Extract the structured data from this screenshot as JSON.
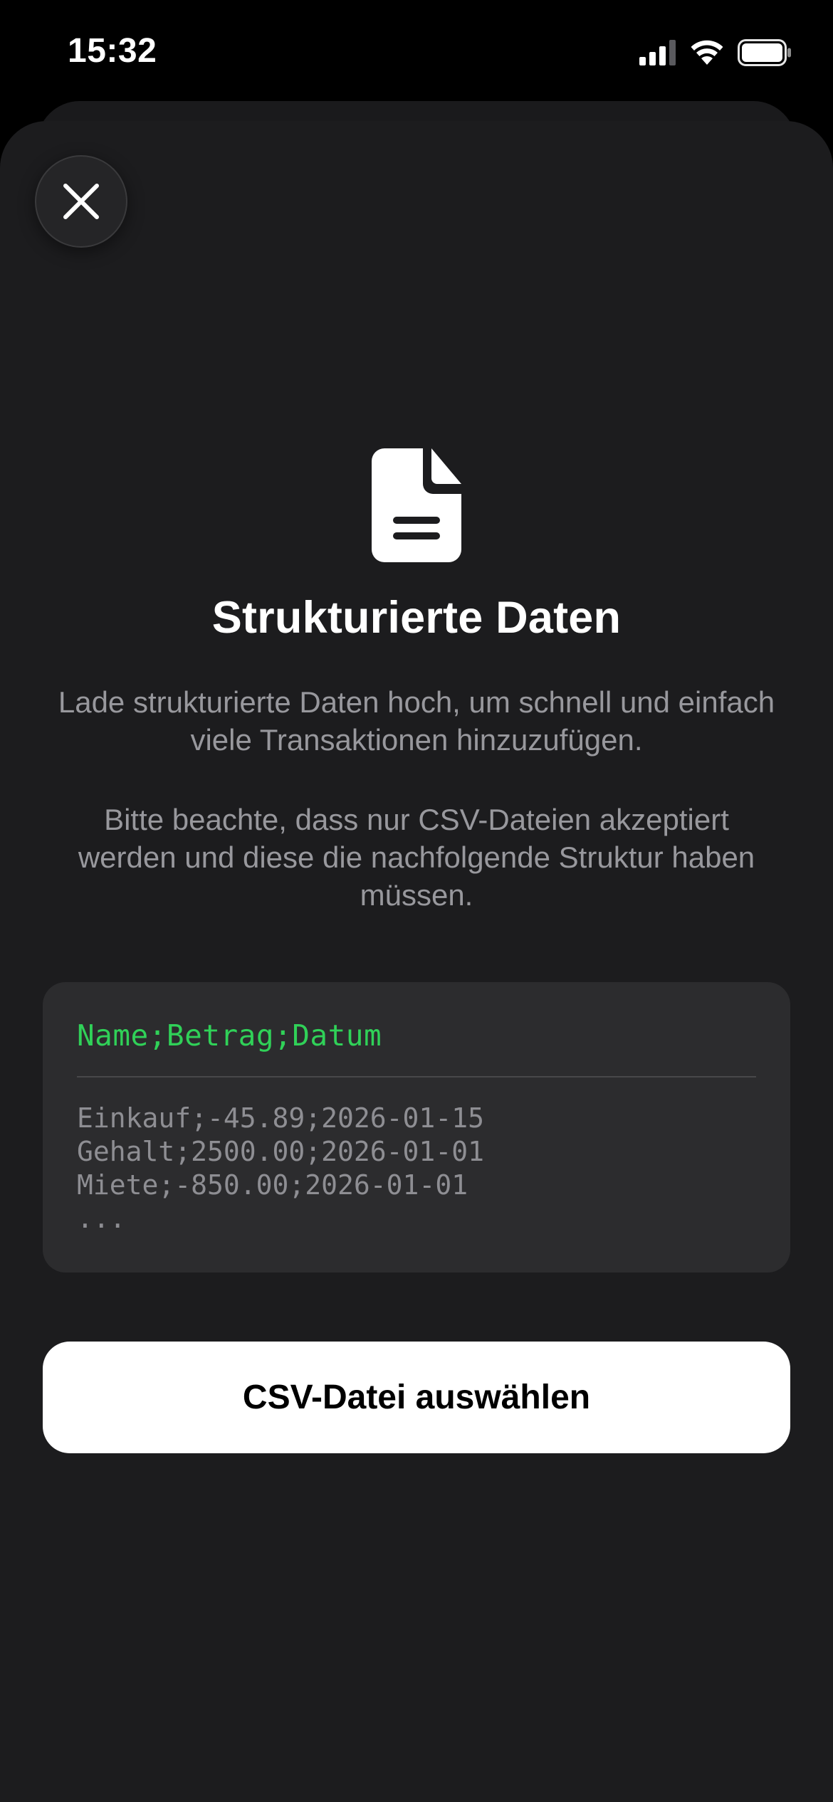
{
  "status_bar": {
    "time": "15:32",
    "signal_icon": "cellular-signal-icon",
    "wifi_icon": "wifi-icon",
    "battery_icon": "battery-icon"
  },
  "sheet": {
    "close_icon": "close-icon",
    "document_icon": "document-icon",
    "title": "Strukturierte Daten",
    "description_1": "Lade strukturierte Daten hoch, um schnell und einfach viele Transaktionen hinzuzufügen.",
    "description_2": "Bitte beachte, dass nur CSV-Dateien akzeptiert werden und diese die nachfolgende Struktur haben müssen.",
    "code_example": {
      "header": "Name;Betrag;Datum",
      "lines": [
        "Einkauf;-45.89;2026-01-15",
        "Gehalt;2500.00;2026-01-01",
        "Miete;-850.00;2026-01-01",
        "..."
      ]
    },
    "primary_button_label": "CSV-Datei auswählen"
  },
  "colors": {
    "background": "#000000",
    "sheet": "#1c1c1e",
    "code_box": "#2c2c2e",
    "code_header": "#30d158",
    "secondary_text": "#98989d",
    "button": "#ffffff"
  }
}
